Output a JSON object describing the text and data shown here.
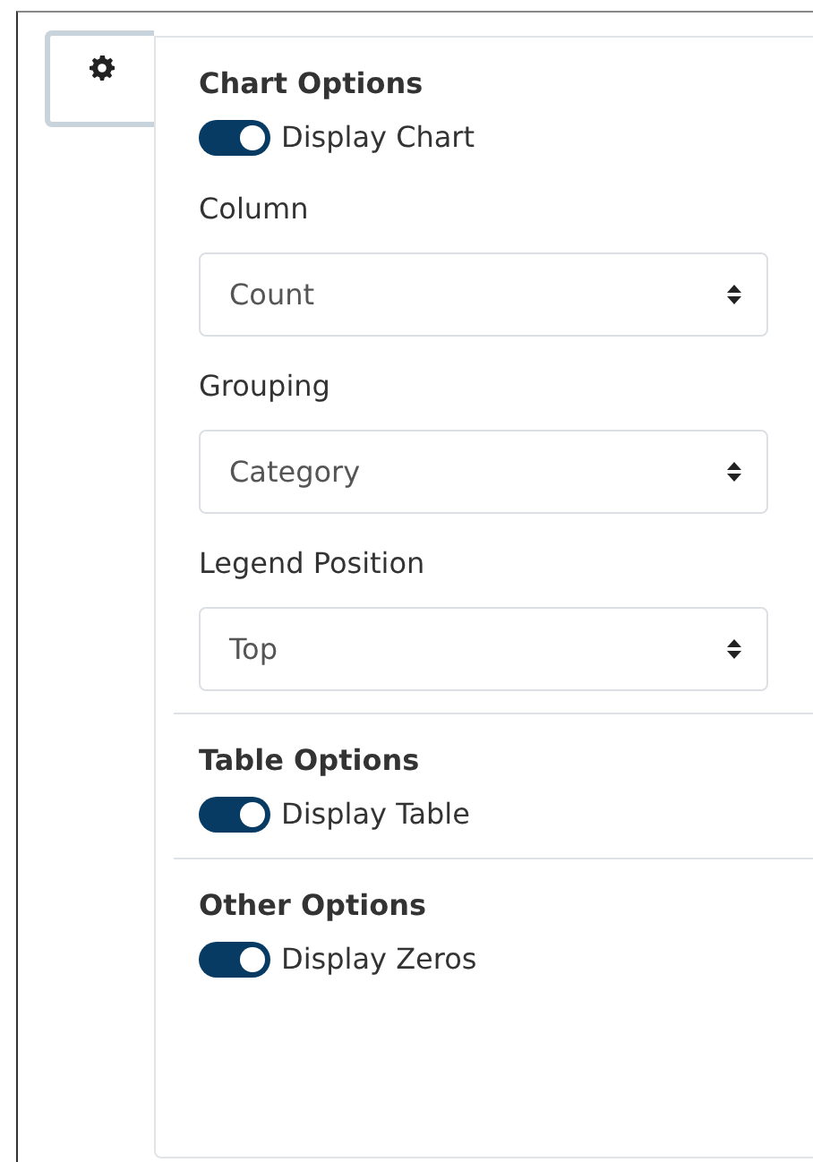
{
  "settings_button": {
    "selected": true
  },
  "sections": [
    {
      "title": "Chart Options",
      "items": [
        {
          "kind": "toggle",
          "label": "Display Chart",
          "on": true
        },
        {
          "kind": "select",
          "label": "Column",
          "value": "Count"
        },
        {
          "kind": "select",
          "label": "Grouping",
          "value": "Category"
        },
        {
          "kind": "select",
          "label": "Legend Position",
          "value": "Top"
        }
      ]
    },
    {
      "title": "Table Options",
      "items": [
        {
          "kind": "toggle",
          "label": "Display Table",
          "on": true
        }
      ]
    },
    {
      "title": "Other Options",
      "items": [
        {
          "kind": "toggle",
          "label": "Display Zeros",
          "on": true
        }
      ]
    }
  ]
}
